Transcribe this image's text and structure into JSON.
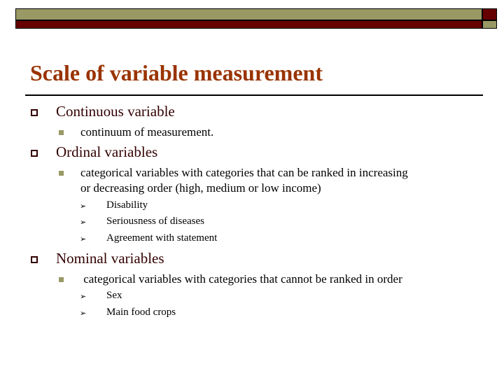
{
  "slide": {
    "title": "Scale of variable measurement",
    "colors": {
      "title": "#993300",
      "accent_olive": "#999966",
      "accent_red": "#660000"
    },
    "bullets": [
      {
        "label": "Continuous variable",
        "children": [
          {
            "label": "continuum of measurement.",
            "children": []
          }
        ]
      },
      {
        "label": "Ordinal variables",
        "children": [
          {
            "label": "categorical variables with categories that can be ranked in increasing or decreasing order (high, medium or low income)",
            "line1": "categorical variables with categories that can be ranked in increasing",
            "line2": "or decreasing order (high, medium or low income)",
            "children": [
              {
                "label": "Disability"
              },
              {
                "label": "Seriousness of diseases"
              },
              {
                "label": "Agreement with statement"
              }
            ]
          }
        ]
      },
      {
        "label": "Nominal variables",
        "children": [
          {
            "label": " categorical variables with categories that cannot be ranked in order",
            "children": [
              {
                "label": "Sex"
              },
              {
                "label": "Main food crops"
              }
            ]
          }
        ]
      }
    ],
    "icons": {
      "level1": "hollow-square",
      "level2": "filled-square",
      "level3": "arrowhead"
    },
    "arrow_glyph": "➢"
  }
}
